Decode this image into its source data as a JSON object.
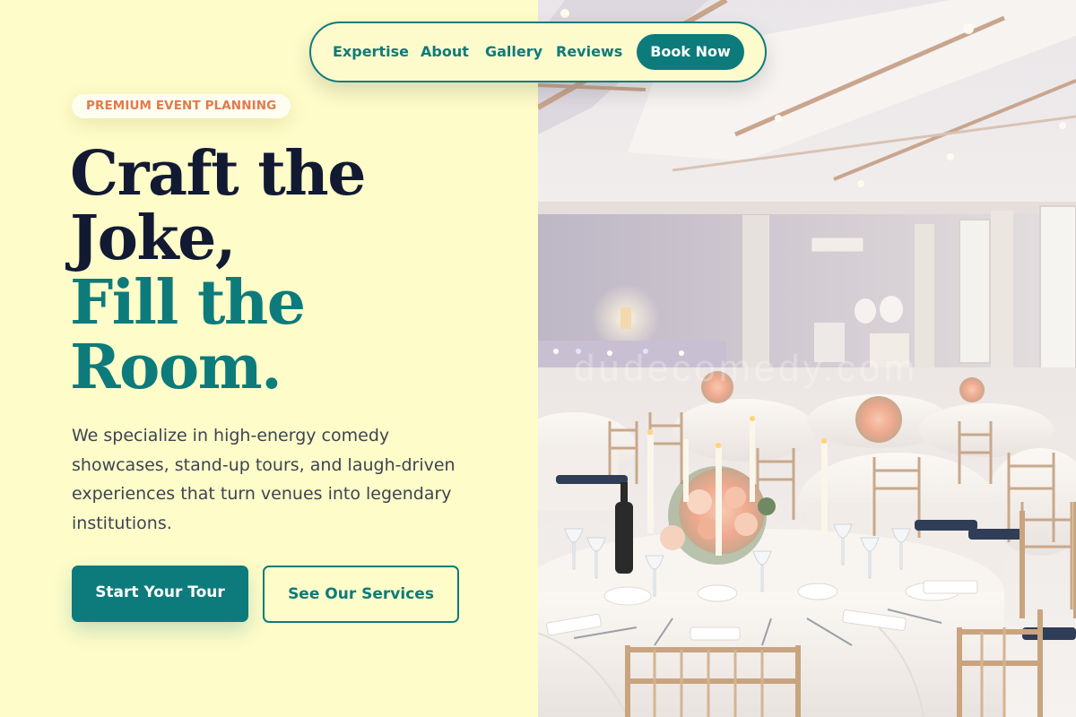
{
  "nav": {
    "links": [
      "Expertise",
      "About",
      "Gallery",
      "Reviews"
    ],
    "cta_label": "Book Now"
  },
  "hero": {
    "badge": "PREMIUM EVENT PLANNING",
    "headline_line1": "Craft the",
    "headline_line2": "Joke,",
    "headline_line3": "Fill the",
    "headline_line4": "Room.",
    "description": "We specialize in high-energy comedy showcases, stand-up tours, and laugh-driven experiences that turn venues into legendary institutions.",
    "primary_button": "Start Your Tour",
    "secondary_button": "See Our Services"
  },
  "image": {
    "watermark": "dudecomedy.com"
  },
  "colors": {
    "background": "#fefcc9",
    "accent": "#0d7b7b",
    "badge_text": "#e27a4f",
    "headline_dark": "#121a33"
  },
  "icons": [
    "banquet-hall-photo"
  ]
}
